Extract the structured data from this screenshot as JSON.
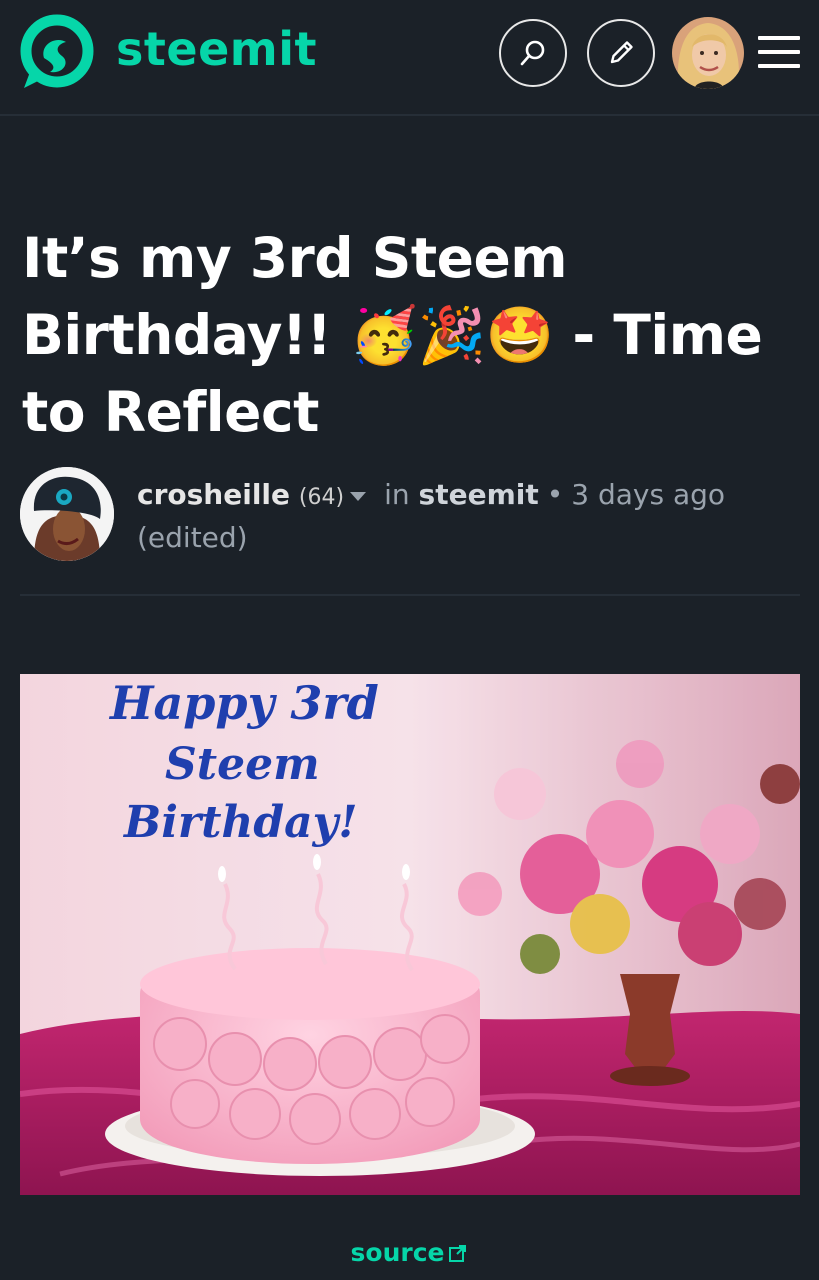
{
  "header": {
    "brand": "steemit",
    "brand_color": "#06d6a9",
    "search_icon": "search-icon",
    "edit_icon": "pencil-icon",
    "menu_icon": "hamburger-menu-icon"
  },
  "post": {
    "title": "It’s my 3rd Steem Birthday!! 🥳🎉🤩 - Time to Reflect",
    "author": "crosheille",
    "reputation": "(64)",
    "in_label": "in",
    "community": "steemit",
    "separator": "•",
    "time": "3 days ago",
    "edited": "(edited)",
    "image_text": [
      "Happy 3rd",
      "Steem",
      "Birthday!"
    ],
    "source_label": "source"
  }
}
